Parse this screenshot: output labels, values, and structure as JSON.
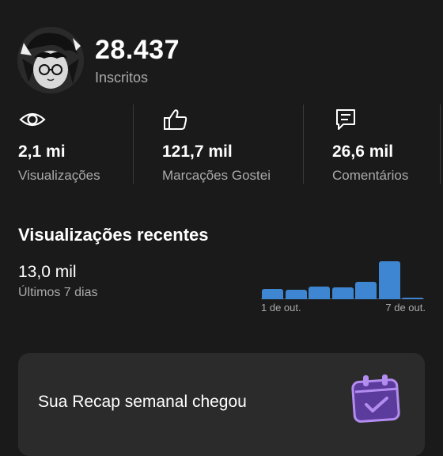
{
  "channel": {
    "subscriber_count": "28.437",
    "subscriber_label": "Inscritos"
  },
  "stats": [
    {
      "icon": "eye-icon",
      "value": "2,1 mi",
      "label": "Visualizações"
    },
    {
      "icon": "thumbs-up-icon",
      "value": "121,7 mil",
      "label": "Marcações Gostei"
    },
    {
      "icon": "comment-icon",
      "value": "26,6 mil",
      "label": "Comentários"
    }
  ],
  "recent_views": {
    "title": "Visualizações recentes",
    "value": "13,0 mil",
    "period": "Últimos 7 dias",
    "x_start_label": "1 de out.",
    "x_end_label": "7 de out."
  },
  "chart_data": {
    "type": "bar",
    "categories": [
      "1 de out.",
      "",
      "",
      "",
      "",
      "",
      "7 de out."
    ],
    "values": [
      0.28,
      0.26,
      0.34,
      0.32,
      0.46,
      1.0,
      0.05
    ],
    "bar_color": "#3e86d1"
  },
  "recap": {
    "text": "Sua Recap semanal chegou",
    "icon": "calendar-check-icon",
    "icon_color": "#b38cf0"
  },
  "colors": {
    "background": "#1a1a1a",
    "card": "#2b2b2b",
    "secondary_text": "#aaaaaa"
  }
}
